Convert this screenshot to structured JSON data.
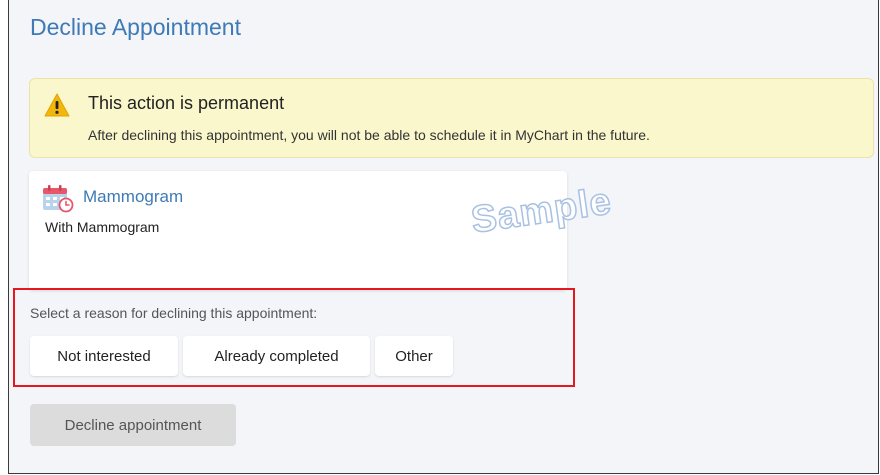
{
  "page": {
    "title": "Decline Appointment"
  },
  "warning": {
    "icon": "warning-icon",
    "title": "This action is permanent",
    "message": "After declining this appointment, you will not be able to schedule it in MyChart in the future."
  },
  "appointment": {
    "icon": "calendar-icon",
    "name": "Mammogram",
    "with": "With Mammogram"
  },
  "watermark": "Sample",
  "reason": {
    "prompt": "Select a reason for declining this appointment:",
    "options": [
      "Not interested",
      "Already completed",
      "Other"
    ]
  },
  "actions": {
    "decline_label": "Decline appointment"
  },
  "colors": {
    "link": "#3e7ab5",
    "warning_bg": "#fbf7cc",
    "warning_icon": "#f3b60b",
    "highlight_border": "#e3191f",
    "disabled_button": "#dcdcdc"
  }
}
